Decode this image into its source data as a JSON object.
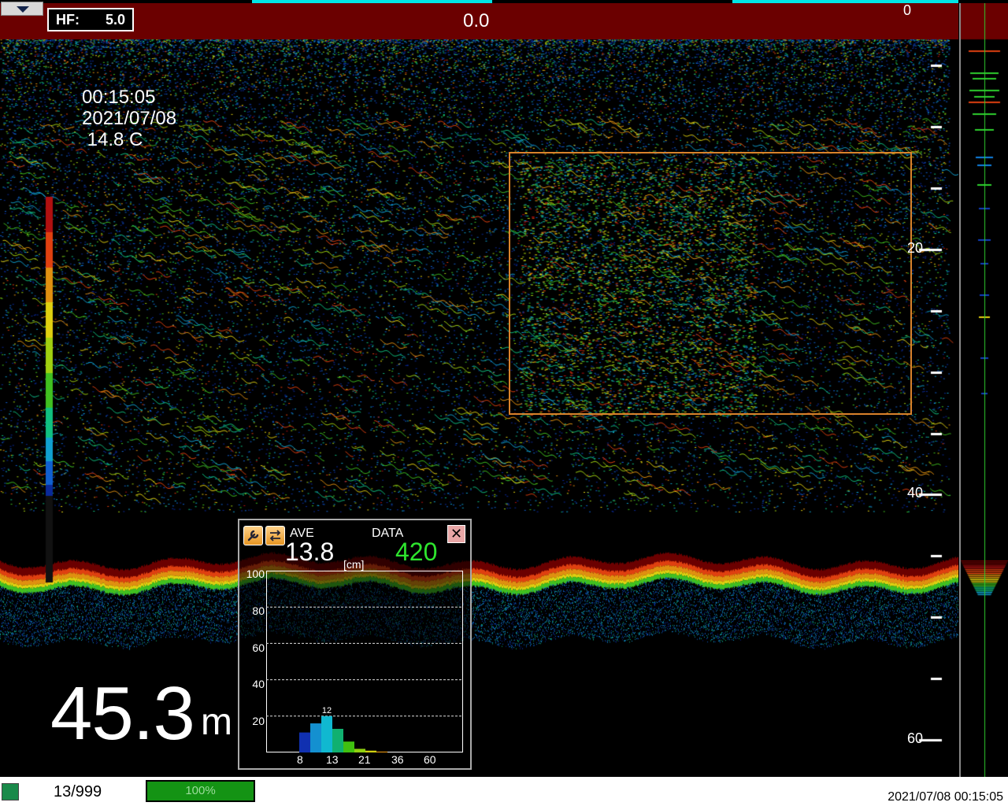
{
  "header": {
    "hf_label": "HF:",
    "hf_value": "5.0",
    "speed": "0.0"
  },
  "overlay": {
    "time": "00:15:05",
    "date": "2021/07/08",
    "temperature": " 14.8 C"
  },
  "depth": {
    "value": "45.3",
    "unit": "m"
  },
  "depth_scale": {
    "labels": [
      "0",
      "20",
      "40",
      "60"
    ],
    "max": 60
  },
  "histogram": {
    "ave_label": "AVE",
    "ave_value": "13.8",
    "data_label": "DATA",
    "data_value": "420",
    "unit": "[cm]",
    "close_label": "✕",
    "icons": [
      "wrench-icon",
      "swap-arrows-icon"
    ],
    "chart_data": {
      "type": "bar",
      "title": "",
      "xlabel": "[cm]",
      "ylabel": "",
      "ylim": [
        0,
        100
      ],
      "yticks": [
        "100",
        "80",
        "60",
        "40",
        "20"
      ],
      "xticks": [
        "8",
        "13",
        "21",
        "36",
        "60"
      ],
      "values": [
        11,
        16,
        20,
        13,
        6,
        2,
        1,
        0.5,
        0,
        0,
        0,
        0,
        0
      ],
      "peak_label": "12",
      "colors": [
        "#1030b0",
        "#1490d0",
        "#10b8d0",
        "#10b070",
        "#40c010",
        "#90d010",
        "#d0d010",
        "#e09010",
        "#d05010",
        "#b02010",
        "#801010",
        "#601010",
        "#401010"
      ]
    }
  },
  "status_bar": {
    "count": "13/999",
    "progress_percent": 100,
    "progress_label": "100%",
    "datetime": "2021/07/08 00:15:05"
  },
  "colors": {
    "header_bg": "#6b0000",
    "accent_cyan": "#00e5e5",
    "roi_border": "#d9822b",
    "data_green": "#2ee52e"
  }
}
